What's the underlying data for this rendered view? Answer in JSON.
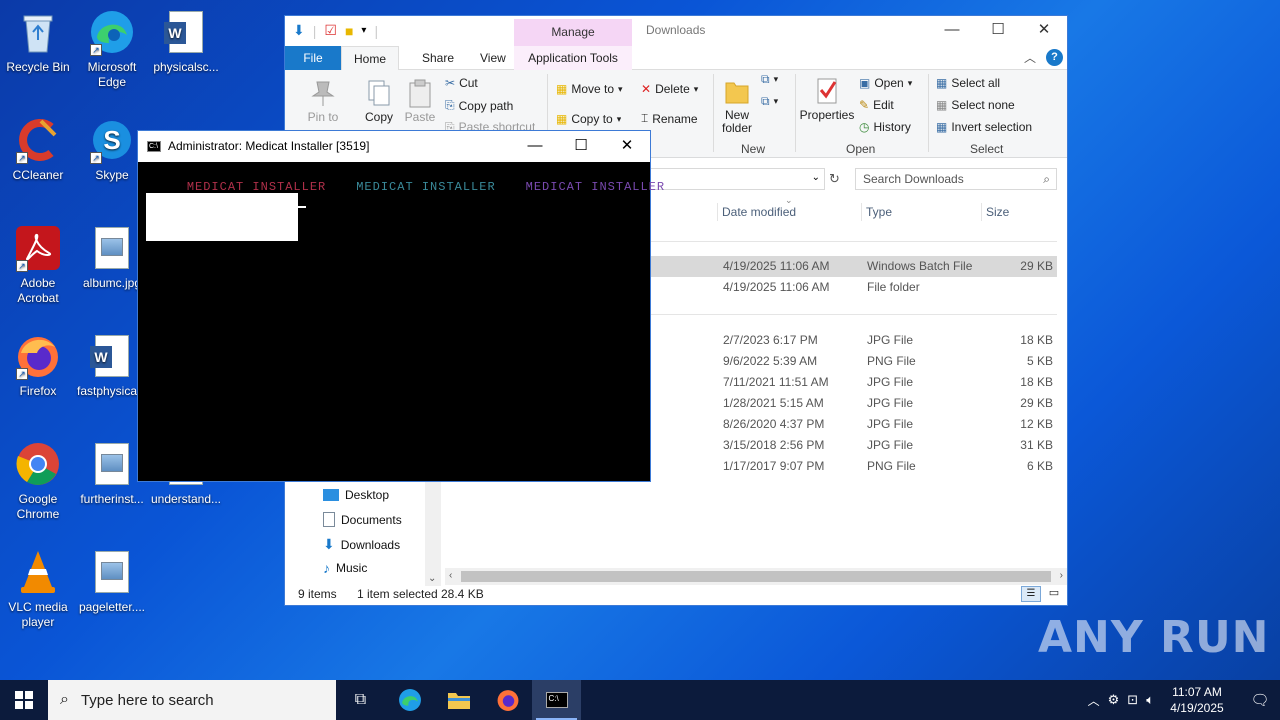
{
  "desktop": {
    "icons": [
      {
        "label": "Recycle Bin"
      },
      {
        "label": "Microsoft Edge"
      },
      {
        "label": "physicalsc..."
      },
      {
        "label": "CCleaner"
      },
      {
        "label": "Skype"
      },
      {
        "label": "Adobe Acrobat"
      },
      {
        "label": "albumc.jpg"
      },
      {
        "label": "Firefox"
      },
      {
        "label": "fastphysica..."
      },
      {
        "label": "Google Chrome"
      },
      {
        "label": "furtherinst..."
      },
      {
        "label": "understand..."
      },
      {
        "label": "VLC media player"
      },
      {
        "label": "pageletter...."
      }
    ],
    "watermark": "ANY RUN"
  },
  "explorer": {
    "title": "Downloads",
    "manage_tab": "Manage",
    "tabs": {
      "file": "File",
      "home": "Home",
      "share": "Share",
      "view": "View",
      "app_tools": "Application Tools"
    },
    "ribbon": {
      "pin": "Pin to Quick access",
      "copy": "Copy",
      "paste": "Paste",
      "cut": "Cut",
      "copy_path": "Copy path",
      "paste_shortcut": "Paste shortcut",
      "move_to": "Move to",
      "copy_to": "Copy to",
      "delete": "Delete",
      "rename": "Rename",
      "new_folder": "New folder",
      "properties": "Properties",
      "open": "Open",
      "edit": "Edit",
      "history": "History",
      "select_all": "Select all",
      "select_none": "Select none",
      "invert_selection": "Invert selection",
      "group_new": "New",
      "group_open": "Open",
      "group_select": "Select"
    },
    "search_placeholder": "Search Downloads",
    "columns": {
      "date": "Date modified",
      "type": "Type",
      "size": "Size"
    },
    "files": [
      {
        "date": "4/19/2025 11:06 AM",
        "type": "Windows Batch File",
        "size": "29 KB"
      },
      {
        "date": "4/19/2025 11:06 AM",
        "type": "File folder",
        "size": ""
      },
      {
        "date": "2/7/2023 6:17 PM",
        "type": "JPG File",
        "size": "18 KB"
      },
      {
        "date": "9/6/2022 5:39 AM",
        "type": "PNG File",
        "size": "5 KB"
      },
      {
        "date": "7/11/2021 11:51 AM",
        "type": "JPG File",
        "size": "18 KB"
      },
      {
        "date": "1/28/2021 5:15 AM",
        "type": "JPG File",
        "size": "29 KB"
      },
      {
        "date": "8/26/2020 4:37 PM",
        "type": "JPG File",
        "size": "12 KB"
      },
      {
        "date": "3/15/2018 2:56 PM",
        "type": "JPG File",
        "size": "31 KB"
      },
      {
        "date": "1/17/2017 9:07 PM",
        "type": "PNG File",
        "size": "6 KB"
      }
    ],
    "nav": [
      {
        "label": "Desktop"
      },
      {
        "label": "Documents"
      },
      {
        "label": "Downloads"
      },
      {
        "label": "Music"
      }
    ],
    "status": {
      "items": "9 items",
      "selected": "1 item selected",
      "size": "28.4 KB"
    }
  },
  "cmd": {
    "title": "Administrator:  Medicat Installer [3519]",
    "banner": [
      "MEDICAT INSTALLER",
      "MEDICAT INSTALLER",
      "MEDICAT INSTALLER"
    ]
  },
  "taskbar": {
    "search_placeholder": "Type here to search",
    "time": "11:07 AM",
    "date": "4/19/2025"
  },
  "colors": {
    "accent": "#1979ca",
    "selection": "#d9d9d9",
    "taskbar": "#0c1b3c"
  }
}
